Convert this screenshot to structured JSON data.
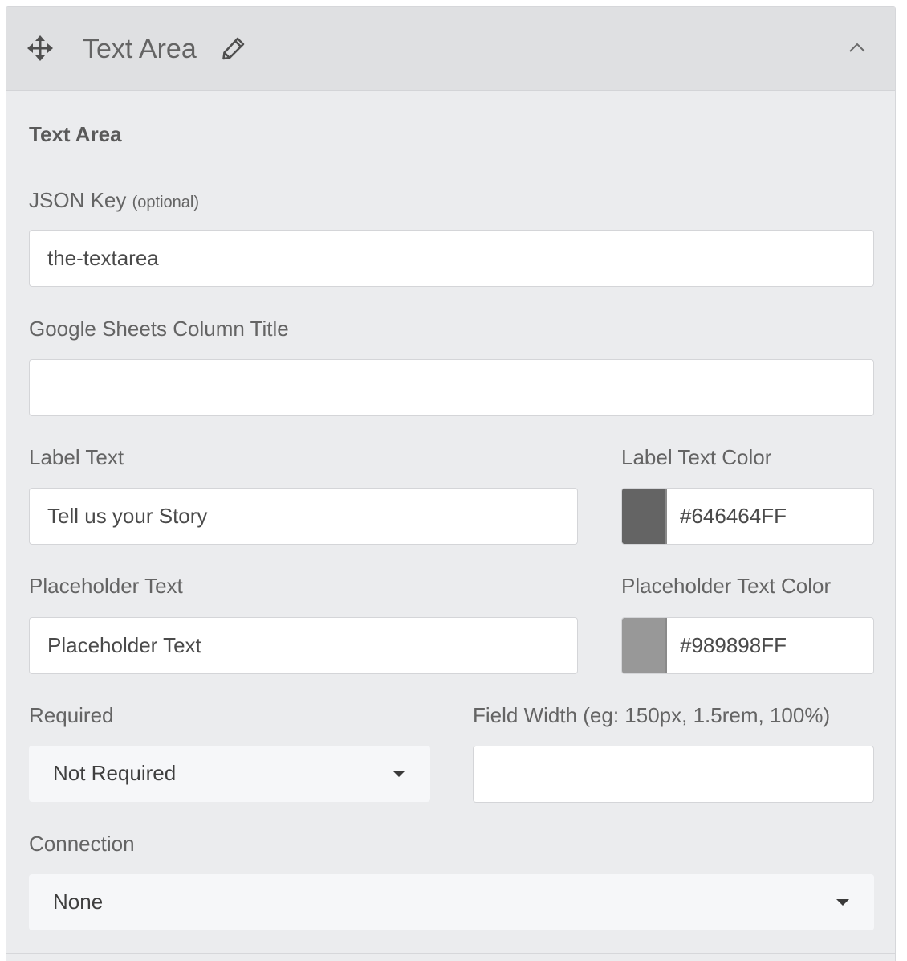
{
  "header": {
    "title": "Text Area",
    "move_icon": "move-arrows-icon",
    "edit_icon": "pencil-icon",
    "collapse_icon": "chevron-up-icon"
  },
  "section": {
    "title": "Text Area"
  },
  "fields": {
    "json_key": {
      "label": "JSON Key",
      "label_suffix": "(optional)",
      "value": "the-textarea"
    },
    "sheets_column": {
      "label": "Google Sheets Column Title",
      "value": ""
    },
    "label_text": {
      "label": "Label Text",
      "value": "Tell us your Story"
    },
    "label_text_color": {
      "label": "Label Text Color",
      "value": "#646464FF",
      "swatch": "#646464"
    },
    "placeholder_text": {
      "label": "Placeholder Text",
      "value": "Placeholder Text"
    },
    "placeholder_text_color": {
      "label": "Placeholder Text Color",
      "value": "#989898FF",
      "swatch": "#989898"
    },
    "required": {
      "label": "Required",
      "selected": "Not Required"
    },
    "field_width": {
      "label": "Field Width (eg: 150px, 1.5rem, 100%)",
      "value": ""
    },
    "connection": {
      "label": "Connection",
      "selected": "None"
    }
  }
}
